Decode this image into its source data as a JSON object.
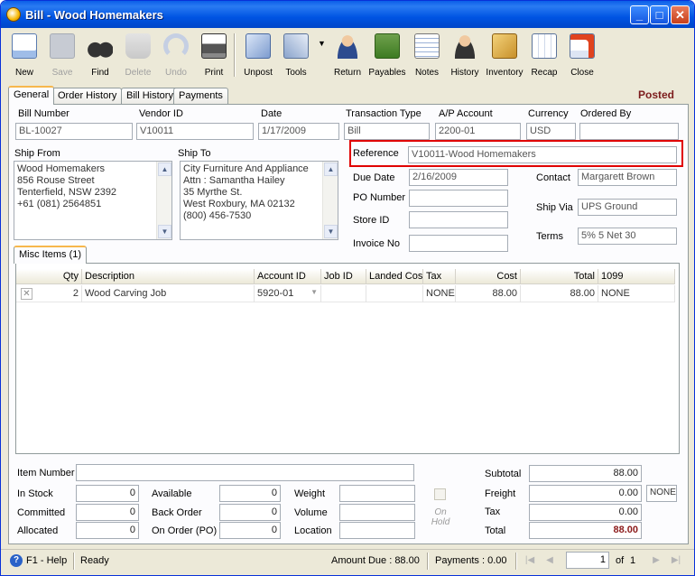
{
  "window": {
    "title": "Bill - Wood Homemakers"
  },
  "toolbar": {
    "items": [
      {
        "label": "New",
        "icon": "new-document-icon",
        "enabled": true
      },
      {
        "label": "Save",
        "icon": "save-disk-icon",
        "enabled": false
      },
      {
        "label": "Find",
        "icon": "binoculars-icon",
        "enabled": true
      },
      {
        "label": "Delete",
        "icon": "recycle-bin-icon",
        "enabled": false
      },
      {
        "label": "Undo",
        "icon": "undo-arrow-icon",
        "enabled": false
      },
      {
        "label": "Print",
        "icon": "printer-icon",
        "enabled": true
      },
      {
        "label": "Unpost",
        "icon": "unpost-icon",
        "enabled": true
      },
      {
        "label": "Tools",
        "icon": "tools-icon",
        "enabled": true
      },
      {
        "label": "Return",
        "icon": "return-person-icon",
        "enabled": true
      },
      {
        "label": "Payables",
        "icon": "payables-money-icon",
        "enabled": true
      },
      {
        "label": "Notes",
        "icon": "notes-pen-icon",
        "enabled": true
      },
      {
        "label": "History",
        "icon": "history-person-icon",
        "enabled": true
      },
      {
        "label": "Inventory",
        "icon": "inventory-boxes-icon",
        "enabled": true
      },
      {
        "label": "Recap",
        "icon": "recap-icon",
        "enabled": true
      },
      {
        "label": "Close",
        "icon": "close-form-icon",
        "enabled": true
      }
    ]
  },
  "tabs": [
    "General",
    "Order History",
    "Bill History",
    "Payments"
  ],
  "status_label": "Posted",
  "header": {
    "bill_number_label": "Bill Number",
    "bill_number": "BL-10027",
    "vendor_id_label": "Vendor ID",
    "vendor_id": "V10011",
    "date_label": "Date",
    "date": "1/17/2009",
    "transaction_type_label": "Transaction Type",
    "transaction_type": "Bill",
    "ap_account_label": "A/P Account",
    "ap_account": "2200-01",
    "currency_label": "Currency",
    "currency": "USD",
    "ordered_by_label": "Ordered By",
    "ordered_by": ""
  },
  "ship_from": {
    "label": "Ship From",
    "lines": [
      "Wood Homemakers",
      "856 Rouse Street",
      "Tenterfield, NSW 2392",
      "+61 (081) 2564851"
    ]
  },
  "ship_to": {
    "label": "Ship To",
    "lines": [
      "City Furniture And Appliance",
      "Attn : Samantha Hailey",
      "35 Myrthe St.",
      "West Roxbury, MA 02132",
      "(800) 456-7530"
    ]
  },
  "details": {
    "reference_label": "Reference",
    "reference": "V10011-Wood Homemakers",
    "due_date_label": "Due Date",
    "due_date": "2/16/2009",
    "po_number_label": "PO Number",
    "po_number": "",
    "store_id_label": "Store ID",
    "store_id": "",
    "invoice_no_label": "Invoice No",
    "invoice_no": "",
    "contact_label": "Contact",
    "contact": "Margarett Brown",
    "ship_via_label": "Ship Via",
    "ship_via": "UPS Ground",
    "terms_label": "Terms",
    "terms": "5% 5 Net 30"
  },
  "items_tab": "Misc Items (1)",
  "grid": {
    "columns": [
      "Qty",
      "Description",
      "Account ID",
      "Job ID",
      "Landed Cos",
      "Tax",
      "Cost",
      "Total",
      "1099"
    ],
    "rows": [
      {
        "qty": "2",
        "description": "Wood Carving Job",
        "account_id": "5920-01",
        "job_id": "",
        "landed_cost": "",
        "tax": "NONE",
        "cost": "88.00",
        "total": "88.00",
        "form_1099": "NONE"
      }
    ]
  },
  "bottom": {
    "item_number_label": "Item Number",
    "item_number": "",
    "in_stock_label": "In Stock",
    "in_stock": "0",
    "committed_label": "Committed",
    "committed": "0",
    "allocated_label": "Allocated",
    "allocated": "0",
    "available_label": "Available",
    "available": "0",
    "back_order_label": "Back Order",
    "back_order": "0",
    "on_order_label": "On Order (PO)",
    "on_order": "0",
    "weight_label": "Weight",
    "weight": "",
    "volume_label": "Volume",
    "volume": "",
    "location_label": "Location",
    "location": "",
    "on_hold_label": "On Hold"
  },
  "totals": {
    "subtotal_label": "Subtotal",
    "subtotal": "88.00",
    "freight_label": "Freight",
    "freight": "0.00",
    "freight_tax": "NONE",
    "tax_label": "Tax",
    "tax": "0.00",
    "total_label": "Total",
    "total": "88.00"
  },
  "statusbar": {
    "help": "F1 - Help",
    "status": "Ready",
    "amount_due": "Amount Due : 88.00",
    "payments": "Payments : 0.00",
    "page": "1",
    "of": "of",
    "page_count": "1"
  }
}
